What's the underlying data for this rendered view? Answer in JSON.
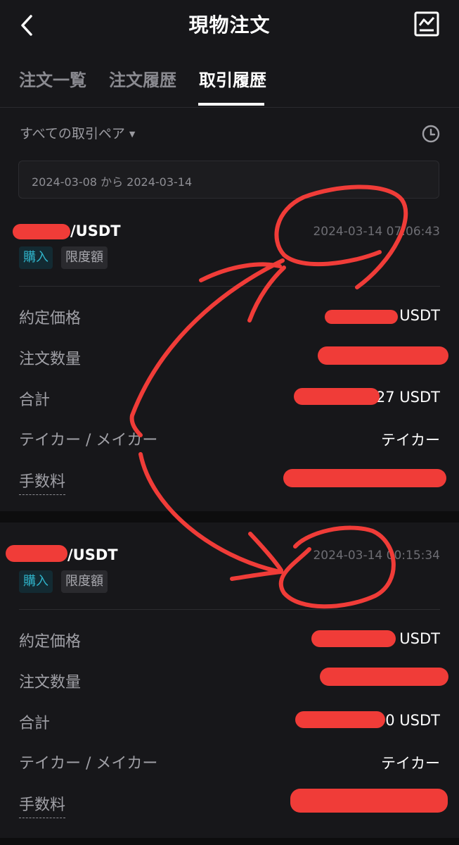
{
  "header": {
    "title": "現物注文",
    "back_icon": "chevron-left-icon",
    "chart_icon": "chart-icon"
  },
  "tabs": [
    {
      "label": "注文一覧",
      "active": false
    },
    {
      "label": "注文履歴",
      "active": false
    },
    {
      "label": "取引履歴",
      "active": true
    }
  ],
  "filter": {
    "pair_label": "すべての取引ペア",
    "caret": "▼",
    "date_range": "2024-03-08 から 2024-03-14"
  },
  "trades": [
    {
      "pair": "/USDT",
      "time": "2024-03-14 07:06:43",
      "side_badge": "購入",
      "type_badge": "限度額",
      "rows": [
        {
          "label": "約定価格",
          "value": "USDT"
        },
        {
          "label": "注文数量",
          "value": ""
        },
        {
          "label": "合計",
          "value": "27 USDT"
        },
        {
          "label": "テイカー / メイカー",
          "value": "テイカー"
        },
        {
          "label": "手数料",
          "value": ""
        }
      ]
    },
    {
      "pair": "/USDT",
      "time": "2024-03-14 00:15:34",
      "side_badge": "購入",
      "type_badge": "限度額",
      "rows": [
        {
          "label": "約定価格",
          "value": "USDT"
        },
        {
          "label": "注文数量",
          "value": ""
        },
        {
          "label": "合計",
          "value": "0 USDT"
        },
        {
          "label": "テイカー / メイカー",
          "value": "テイカー"
        },
        {
          "label": "手数料",
          "value": ""
        }
      ]
    }
  ],
  "colors": {
    "background": "#17171a",
    "buy_accent": "#2fb3c9",
    "annotation": "#f03c38"
  }
}
